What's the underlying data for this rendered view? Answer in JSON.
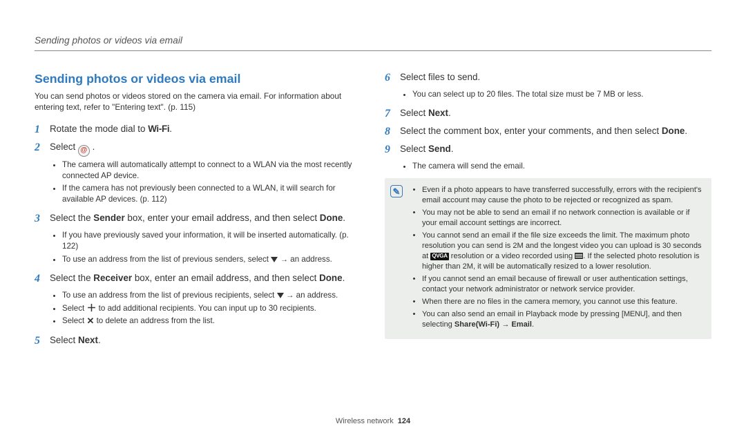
{
  "header": {
    "breadcrumb": "Sending photos or videos via email"
  },
  "section": {
    "title": "Sending photos or videos via email",
    "intro": "You can send photos or videos stored on the camera via email. For information about entering text, refer to \"Entering text\". (p. 115)"
  },
  "steps_left": {
    "s1": {
      "num": "1",
      "pre": "Rotate the mode dial to ",
      "wifi": "Wi-Fi",
      "post": "."
    },
    "s2": {
      "num": "2",
      "pre": "Select ",
      "post": " ."
    },
    "s2_bullets": [
      "The camera will automatically attempt to connect to a WLAN via the most recently connected AP device.",
      "If the camera has not previously been connected to a WLAN, it will search for available AP devices. (p. 112)"
    ],
    "s3": {
      "num": "3",
      "text_pre": "Select the ",
      "b1": "Sender",
      "text_mid": " box, enter your email address, and then select ",
      "b2": "Done",
      "text_post": "."
    },
    "s3_bullets_a": "If you have previously saved your information, it will be inserted automatically. (p. 122)",
    "s3_bullets_b_pre": "To use an address from the list of previous senders, select ",
    "s3_bullets_b_post": " → an address.",
    "s4": {
      "num": "4",
      "text_pre": "Select the ",
      "b1": "Receiver",
      "text_mid": " box, enter an email address, and then select ",
      "b2": "Done",
      "text_post": "."
    },
    "s4_bullets_a_pre": "To use an address from the list of previous recipients, select ",
    "s4_bullets_a_post": " → an address.",
    "s4_bullets_b_pre": "Select ",
    "s4_bullets_b_post": " to add additional recipients. You can input up to 30 recipients.",
    "s4_bullets_c_pre": "Select ",
    "s4_bullets_c_post": " to delete an address from the list.",
    "s5": {
      "num": "5",
      "pre": "Select ",
      "b": "Next",
      "post": "."
    }
  },
  "steps_right": {
    "s6": {
      "num": "6",
      "text": "Select files to send."
    },
    "s6_bullets": [
      "You can select up to 20 files. The total size must be 7 MB or less."
    ],
    "s7": {
      "num": "7",
      "pre": "Select ",
      "b": "Next",
      "post": "."
    },
    "s8": {
      "num": "8",
      "text_pre": "Select the comment box, enter your comments, and then select ",
      "b": "Done",
      "text_post": "."
    },
    "s9": {
      "num": "9",
      "pre": "Select ",
      "b": "Send",
      "post": "."
    },
    "s9_bullets": [
      "The camera will send the email."
    ]
  },
  "notes": {
    "n1": "Even if a photo appears to have transferred successfully, errors with the recipient's email account may cause the photo to be rejected or recognized as spam.",
    "n2": "You may not be able to send an email if no network connection is available or if your email account settings are incorrect.",
    "n3_pre": "You cannot send an email if the file size exceeds the limit. The maximum photo resolution you can send is 2M and the longest video you can upload is 30 seconds at ",
    "n3_qvga": "QVGA",
    "n3_mid": " resolution or a video recorded using ",
    "n3_post": ". If the selected photo resolution is higher than 2M, it will be automatically resized to a lower resolution.",
    "n4": "If you cannot send an email because of firewall or user authentication settings, contact your network administrator or network service provider.",
    "n5": "When there are no files in the camera memory, you cannot use this feature.",
    "n6_pre": "You can also send an email in Playback mode by pressing [",
    "n6_menu": "MENU",
    "n6_mid": "], and then selecting ",
    "n6_b1": "Share(Wi-Fi)",
    "n6_arr": " → ",
    "n6_b2": "Email",
    "n6_post": "."
  },
  "footer": {
    "section": "Wireless network",
    "page": "124"
  }
}
